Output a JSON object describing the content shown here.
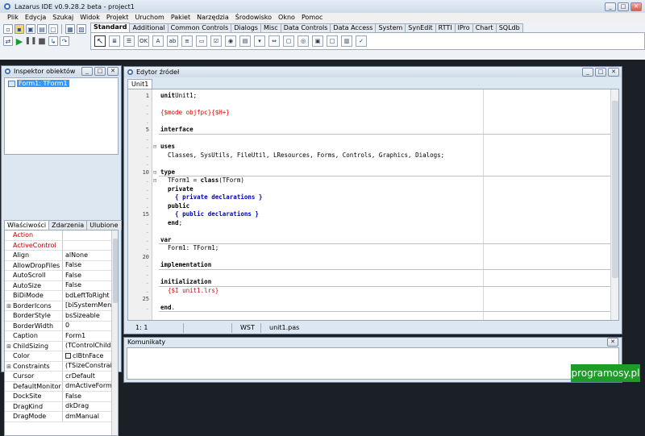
{
  "window": {
    "title": "Lazarus IDE v0.9.28.2 beta - project1"
  },
  "menu": [
    "Plik",
    "Edycja",
    "Szukaj",
    "Widok",
    "Projekt",
    "Uruchom",
    "Pakiet",
    "Narzędzia",
    "Środowisko",
    "Okno",
    "Pomoc"
  ],
  "palette": {
    "tabs": [
      "Standard",
      "Additional",
      "Common Controls",
      "Dialogs",
      "Misc",
      "Data Controls",
      "Data Access",
      "System",
      "SynEdit",
      "RTTI",
      "IPro",
      "Chart",
      "SQLdb"
    ],
    "active_tab": "Standard"
  },
  "inspector": {
    "title": "Inspektor obiektów",
    "tree_node": "Form1: TForm1",
    "tabs": [
      "Właściwości",
      "Zdarzenia",
      "Ulubione"
    ],
    "properties": [
      {
        "name": "Action",
        "value": "",
        "red": true,
        "expand": false
      },
      {
        "name": "ActiveControl",
        "value": "",
        "red": true,
        "expand": false
      },
      {
        "name": "Align",
        "value": "alNone",
        "red": false,
        "expand": false
      },
      {
        "name": "AllowDropFiles",
        "value": "False",
        "red": false,
        "expand": false
      },
      {
        "name": "AutoScroll",
        "value": "False",
        "red": false,
        "expand": false
      },
      {
        "name": "AutoSize",
        "value": "False",
        "red": false,
        "expand": false
      },
      {
        "name": "BiDiMode",
        "value": "bdLeftToRight",
        "red": false,
        "expand": false
      },
      {
        "name": "BorderIcons",
        "value": "[biSystemMenu,b",
        "red": false,
        "expand": true
      },
      {
        "name": "BorderStyle",
        "value": "bsSizeable",
        "red": false,
        "expand": false
      },
      {
        "name": "BorderWidth",
        "value": "0",
        "red": false,
        "expand": false
      },
      {
        "name": "Caption",
        "value": "Form1",
        "red": false,
        "expand": false
      },
      {
        "name": "ChildSizing",
        "value": "(TControlChildSiz",
        "red": false,
        "expand": true
      },
      {
        "name": "Color",
        "value": "clBtnFace",
        "red": false,
        "expand": false,
        "swatch": true
      },
      {
        "name": "Constraints",
        "value": "(TSizeConstraint",
        "red": false,
        "expand": true
      },
      {
        "name": "Cursor",
        "value": "crDefault",
        "red": false,
        "expand": false
      },
      {
        "name": "DefaultMonitor",
        "value": "dmActiveForm",
        "red": false,
        "expand": false
      },
      {
        "name": "DockSite",
        "value": "False",
        "red": false,
        "expand": false
      },
      {
        "name": "DragKind",
        "value": "dkDrag",
        "red": false,
        "expand": false
      },
      {
        "name": "DragMode",
        "value": "dmManual",
        "red": false,
        "expand": false
      }
    ]
  },
  "editor": {
    "title": "Edytor źródeł",
    "tab": "Unit1",
    "lines": [
      {
        "n": "1",
        "fold": "",
        "parts": [
          [
            "kw",
            "unit"
          ],
          [
            "",
            "Unit1;"
          ]
        ]
      },
      {
        "n": ".",
        "fold": "",
        "parts": []
      },
      {
        "n": ".",
        "fold": "",
        "parts": [
          [
            "dir",
            "{$mode objfpc}{$H+}"
          ]
        ]
      },
      {
        "n": ".",
        "fold": "",
        "parts": []
      },
      {
        "n": "5",
        "fold": "",
        "parts": [
          [
            "kw",
            "interface"
          ]
        ]
      },
      {
        "n": ".",
        "fold": "",
        "parts": []
      },
      {
        "n": ".",
        "fold": "⊟",
        "parts": [
          [
            "kw",
            "uses"
          ]
        ]
      },
      {
        "n": ".",
        "fold": "",
        "parts": [
          [
            "",
            "  Classes, SysUtils, FileUtil, LResources, Forms, Controls, Graphics, Dialogs;"
          ]
        ]
      },
      {
        "n": ".",
        "fold": "",
        "parts": []
      },
      {
        "n": "10",
        "fold": "⊟",
        "parts": [
          [
            "kw",
            "type"
          ]
        ]
      },
      {
        "n": ".",
        "fold": "⊟",
        "parts": [
          [
            "",
            "  TForm1 = "
          ],
          [
            "kw",
            "class"
          ],
          [
            "",
            "(TForm)"
          ]
        ]
      },
      {
        "n": ".",
        "fold": "",
        "parts": [
          [
            "kw",
            "  private"
          ]
        ]
      },
      {
        "n": ".",
        "fold": "",
        "parts": [
          [
            "cmt",
            "    { private declarations }"
          ]
        ]
      },
      {
        "n": ".",
        "fold": "",
        "parts": [
          [
            "kw",
            "  public"
          ]
        ]
      },
      {
        "n": "15",
        "fold": "",
        "parts": [
          [
            "cmt",
            "    { public declarations }"
          ]
        ]
      },
      {
        "n": ".",
        "fold": "",
        "parts": [
          [
            "kw",
            "  end"
          ],
          [
            "",
            ";"
          ]
        ]
      },
      {
        "n": ".",
        "fold": "",
        "parts": []
      },
      {
        "n": ".",
        "fold": "",
        "parts": [
          [
            "kw",
            "var"
          ]
        ]
      },
      {
        "n": ".",
        "fold": "",
        "parts": [
          [
            "",
            "  Form1: TForm1;"
          ]
        ]
      },
      {
        "n": "20",
        "fold": "",
        "parts": []
      },
      {
        "n": ".",
        "fold": "",
        "parts": [
          [
            "kw",
            "implementation"
          ]
        ]
      },
      {
        "n": ".",
        "fold": "",
        "parts": []
      },
      {
        "n": ".",
        "fold": "",
        "parts": [
          [
            "kw",
            "initialization"
          ]
        ]
      },
      {
        "n": ".",
        "fold": "",
        "parts": [
          [
            "dir",
            "  {$I unit1.lrs}"
          ]
        ]
      },
      {
        "n": "25",
        "fold": "",
        "parts": []
      },
      {
        "n": ".",
        "fold": "",
        "parts": [
          [
            "kw",
            "end"
          ],
          [
            "",
            "."
          ]
        ]
      }
    ],
    "separators_after": [
      4,
      9,
      17,
      20,
      22,
      25
    ],
    "status": {
      "pos": "1:  1",
      "mode": "",
      "ins": "WST",
      "file": "unit1.pas"
    }
  },
  "messages": {
    "title": "Komunikaty"
  },
  "watermark": "programosy.pl"
}
